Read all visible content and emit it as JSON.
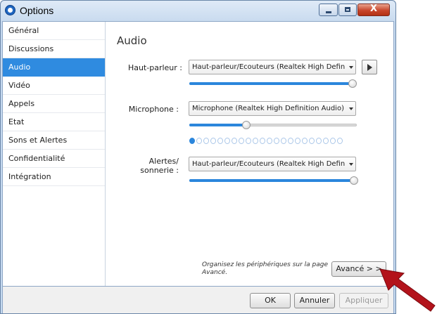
{
  "window": {
    "title": "Options",
    "minimize_glyph": "minimize",
    "maximize_glyph": "maximize",
    "close_glyph": "X"
  },
  "sidebar": {
    "items": [
      {
        "label": "Général"
      },
      {
        "label": "Discussions"
      },
      {
        "label": "Audio",
        "active": true
      },
      {
        "label": "Vidéo"
      },
      {
        "label": "Appels"
      },
      {
        "label": "Etat"
      },
      {
        "label": "Sons et Alertes"
      },
      {
        "label": "Confidentialité"
      },
      {
        "label": "Intégration"
      }
    ]
  },
  "audio": {
    "title": "Audio",
    "speaker": {
      "label": "Haut-parleur :",
      "device": "Haut-parleur/Ecouteurs (Realtek High Definiti...",
      "volume_fraction": 1.0
    },
    "microphone": {
      "label": "Microphone :",
      "device": "Microphone (Realtek High Definition Audio)",
      "volume_fraction": 0.35,
      "level_dots_total": 22,
      "level_dots_lit": 1
    },
    "alerts": {
      "label_line1": "Alertes/",
      "label_line2": "sonnerie :",
      "device": "Haut-parleur/Ecouteurs (Realtek High Definiti...",
      "volume_fraction": 1.0
    },
    "hint": "Organisez les périphériques sur la page Avancé.",
    "advanced_button": "Avancé > >"
  },
  "footer": {
    "ok": "OK",
    "cancel": "Annuler",
    "apply": "Appliquer"
  },
  "colors": {
    "accent": "#2f8be0",
    "slider_fill": "#2b86dc",
    "annotation_arrow": "#b3131b"
  }
}
